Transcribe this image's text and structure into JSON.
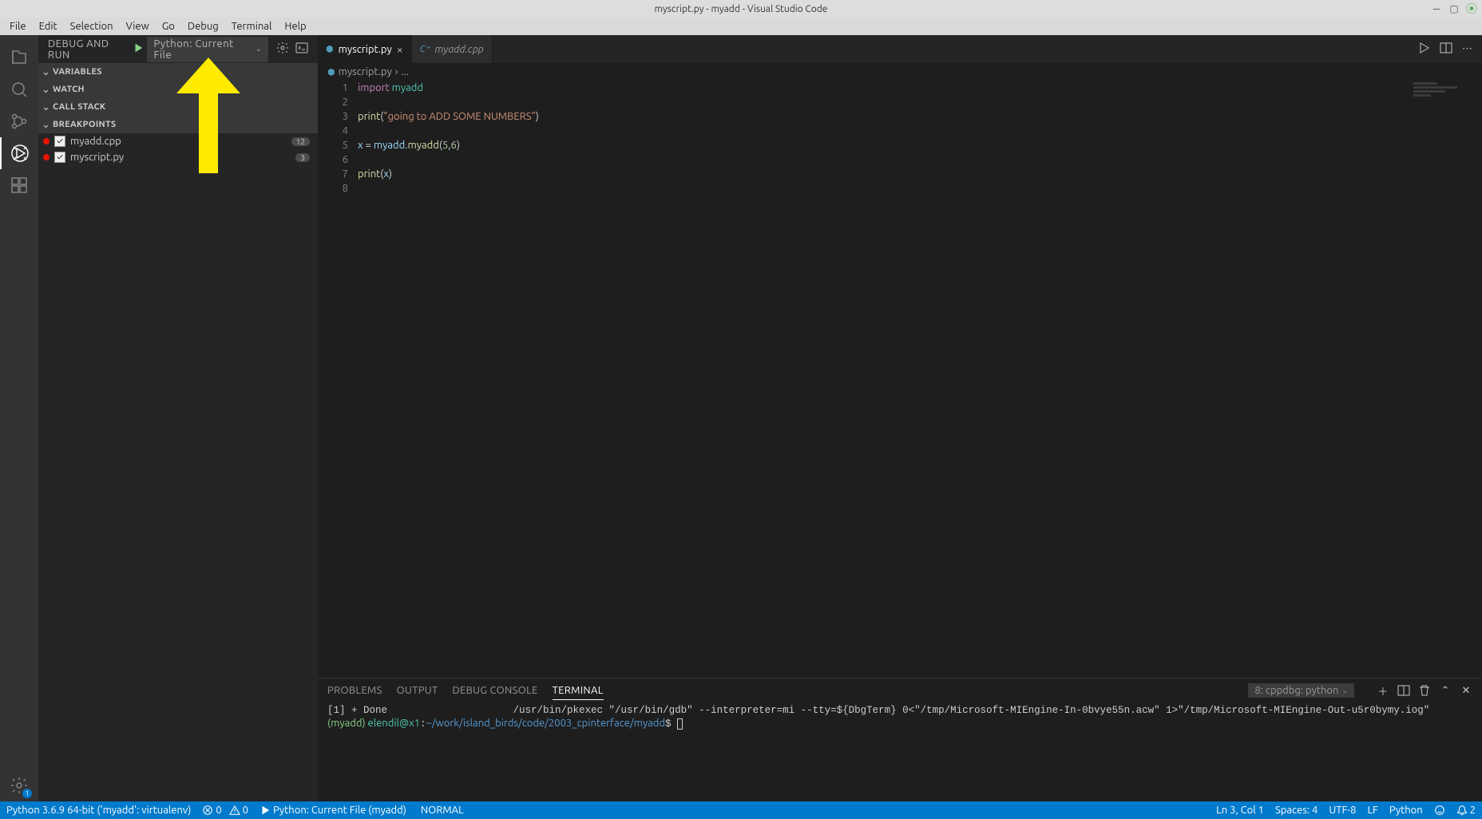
{
  "titlebar": {
    "title": "myscript.py - myadd - Visual Studio Code"
  },
  "menubar": [
    "File",
    "Edit",
    "Selection",
    "View",
    "Go",
    "Debug",
    "Terminal",
    "Help"
  ],
  "sidebar": {
    "title": "DEBUG AND RUN",
    "config": "Python: Current File",
    "sections": {
      "variables": "VARIABLES",
      "watch": "WATCH",
      "callstack": "CALL STACK",
      "breakpoints": "BREAKPOINTS"
    },
    "breakpoints": [
      {
        "file": "myadd.cpp",
        "count": "12"
      },
      {
        "file": "myscript.py",
        "count": "3"
      }
    ]
  },
  "tabs": [
    {
      "label": "myscript.py",
      "active": true,
      "modified": false
    },
    {
      "label": "myadd.cpp",
      "active": false,
      "modified": true
    }
  ],
  "breadcrumb": {
    "file": "myscript.py",
    "rest": "..."
  },
  "code": {
    "bpLine": 3,
    "lines": [
      {
        "n": 1,
        "html": "<span class='tok-kw'>import</span> <span class='tok-mod'>myadd</span>"
      },
      {
        "n": 2,
        "html": ""
      },
      {
        "n": 3,
        "html": "<span class='tok-fn'>print</span><span class='tok-def'>(</span><span class='tok-str'>\"going to ADD SOME NUMBERS\"</span><span class='tok-def'>)</span>"
      },
      {
        "n": 4,
        "html": ""
      },
      {
        "n": 5,
        "html": "<span class='tok-var'>x</span> <span class='tok-def'>=</span> <span class='tok-var'>myadd</span><span class='tok-def'>.</span><span class='tok-fn'>myadd</span><span class='tok-def'>(</span><span class='tok-num'>5</span><span class='tok-def'>,</span><span class='tok-num'>6</span><span class='tok-def'>)</span>"
      },
      {
        "n": 6,
        "html": ""
      },
      {
        "n": 7,
        "html": "<span class='tok-fn'>print</span><span class='tok-def'>(</span><span class='tok-var'>x</span><span class='tok-def'>)</span>"
      },
      {
        "n": 8,
        "html": ""
      }
    ]
  },
  "bottompanel": {
    "tabs": [
      "PROBLEMS",
      "OUTPUT",
      "DEBUG CONSOLE",
      "TERMINAL"
    ],
    "active": 3,
    "select": "8: cppdbg: python",
    "terminal": {
      "line1_pre": "[1] + Done",
      "line1_cmd": "/usr/bin/pkexec \"/usr/bin/gdb\" --interpreter=mi --tty=${DbgTerm} 0<\"/tmp/Microsoft-MIEngine-In-0bvye55n.acw\" 1>\"/tmp/Microsoft-MIEngine-Out-u5r0bymy.iog\"",
      "prompt_env": "(myadd) ",
      "prompt_userhost": "elendil@x1",
      "prompt_sep": ":",
      "prompt_path": "~/work/island_birds/code/2003_cpinterface/myadd",
      "prompt_dollar": "$"
    }
  },
  "statusbar": {
    "python": "Python 3.6.9 64-bit ('myadd': virtualenv)",
    "errors": "0",
    "warnings": "0",
    "debug": "Python: Current File (myadd)",
    "mode": "NORMAL",
    "position": "Ln 3, Col 1",
    "spaces": "Spaces: 4",
    "encoding": "UTF-8",
    "eol": "LF",
    "language": "Python",
    "notifications": "2"
  }
}
